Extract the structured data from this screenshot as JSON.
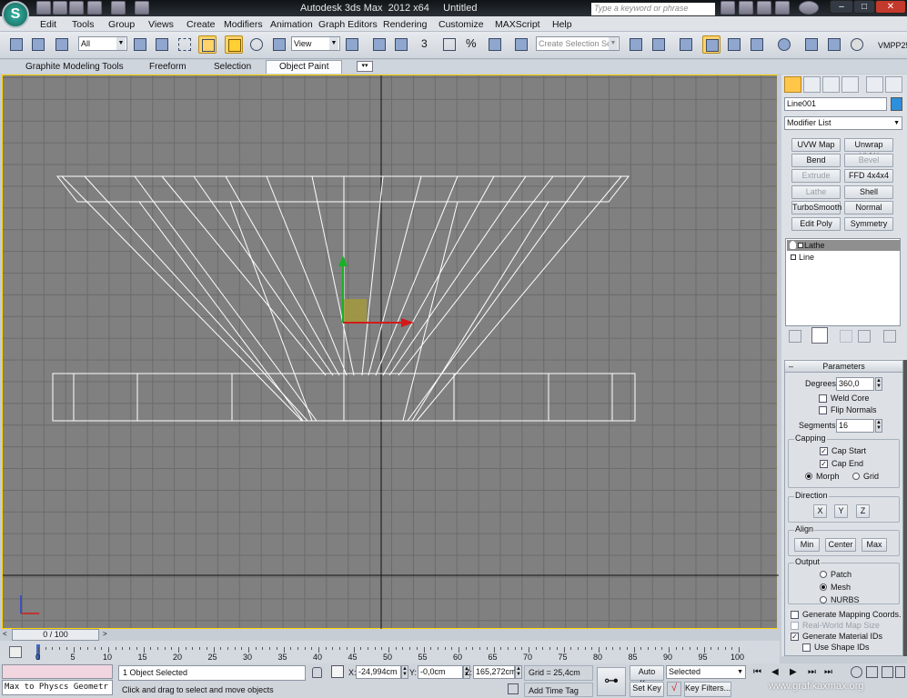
{
  "app": {
    "title": "Autodesk 3ds Max  2012 x64     Untitled",
    "search_placeholder": "Type a keyword or phrase",
    "win_controls": [
      "–",
      "□",
      "✕"
    ]
  },
  "menu": [
    "Edit",
    "Tools",
    "Group",
    "Views",
    "Create",
    "Modifiers",
    "Animation",
    "Graph Editors",
    "Rendering",
    "Customize",
    "MAXScript",
    "Help"
  ],
  "toolbar": {
    "selection_filter": "All",
    "ref_coord": "View",
    "snap_num": "3",
    "create_selection_set": "Create Selection Se",
    "vmpp_label": "VMPP25"
  },
  "ribbon": {
    "tabs": [
      "Graphite Modeling Tools",
      "Freeform",
      "Selection",
      "Object Paint"
    ],
    "active": "Object Paint"
  },
  "panel": {
    "object_name": "Line001",
    "object_color": "#2e8fdc",
    "modifier_list": "Modifier List",
    "modifier_buttons": [
      {
        "label": "UVW Map",
        "enabled": true
      },
      {
        "label": "Unwrap UVW",
        "enabled": true
      },
      {
        "label": "Bend",
        "enabled": true
      },
      {
        "label": "Bevel",
        "enabled": false
      },
      {
        "label": "Extrude",
        "enabled": false
      },
      {
        "label": "FFD 4x4x4",
        "enabled": true
      },
      {
        "label": "Lathe",
        "enabled": false
      },
      {
        "label": "Shell",
        "enabled": true
      },
      {
        "label": "TurboSmooth",
        "enabled": true
      },
      {
        "label": "Normal",
        "enabled": true
      },
      {
        "label": "Edit Poly",
        "enabled": true
      },
      {
        "label": "Symmetry",
        "enabled": true
      }
    ],
    "stack": [
      {
        "label": "Lathe",
        "selected": true
      },
      {
        "label": "Line",
        "selected": false
      }
    ],
    "params": {
      "rollout_title": "Parameters",
      "degrees_label": "Degrees:",
      "degrees": "360,0",
      "weld_core": "Weld Core",
      "weld_core_checked": false,
      "flip_normals": "Flip Normals",
      "flip_normals_checked": false,
      "segments_label": "Segments:",
      "segments": "16",
      "capping_label": "Capping",
      "cap_start": "Cap Start",
      "cap_start_checked": true,
      "cap_end": "Cap End",
      "cap_end_checked": true,
      "morph": "Morph",
      "grid": "Grid",
      "capping_mode": "Morph",
      "direction_label": "Direction",
      "dir_x": "X",
      "dir_y": "Y",
      "dir_z": "Z",
      "align_label": "Align",
      "align_min": "Min",
      "align_center": "Center",
      "align_max": "Max",
      "output_label": "Output",
      "patch": "Patch",
      "mesh": "Mesh",
      "nurbs": "NURBS",
      "output_mode": "Mesh",
      "gen_map_coords": "Generate Mapping Coords.",
      "gen_map_coords_checked": false,
      "real_world": "Real-World Map Size",
      "real_world_checked": false,
      "gen_mat_ids": "Generate Material IDs",
      "gen_mat_ids_checked": true,
      "use_shape_ids": "Use Shape IDs",
      "use_shape_ids_checked": false
    }
  },
  "timeline": {
    "slider": "0 / 100",
    "ticks": [
      "0",
      "5",
      "10",
      "15",
      "20",
      "25",
      "30",
      "35",
      "40",
      "45",
      "50",
      "55",
      "60",
      "65",
      "70",
      "75",
      "80",
      "85",
      "90",
      "95",
      "100"
    ]
  },
  "status": {
    "listener": "Max to Physcs Geometr",
    "selected_text": "1 Object Selected",
    "prompt": "Click and drag to select and move objects",
    "x_label": "X:",
    "x": "-24,994cm",
    "y_label": "Y:",
    "y": "-0,0cm",
    "z_label": "Z:",
    "z": "165,272cm",
    "grid": "Grid = 25,4cm",
    "add_time_tag": "Add Time Tag",
    "auto_key": "Auto Key",
    "selected_dropdown": "Selected",
    "set_key": "Set Key",
    "key_filters": "Key Filters...",
    "watermark": "www.grafikaxmax.org"
  }
}
